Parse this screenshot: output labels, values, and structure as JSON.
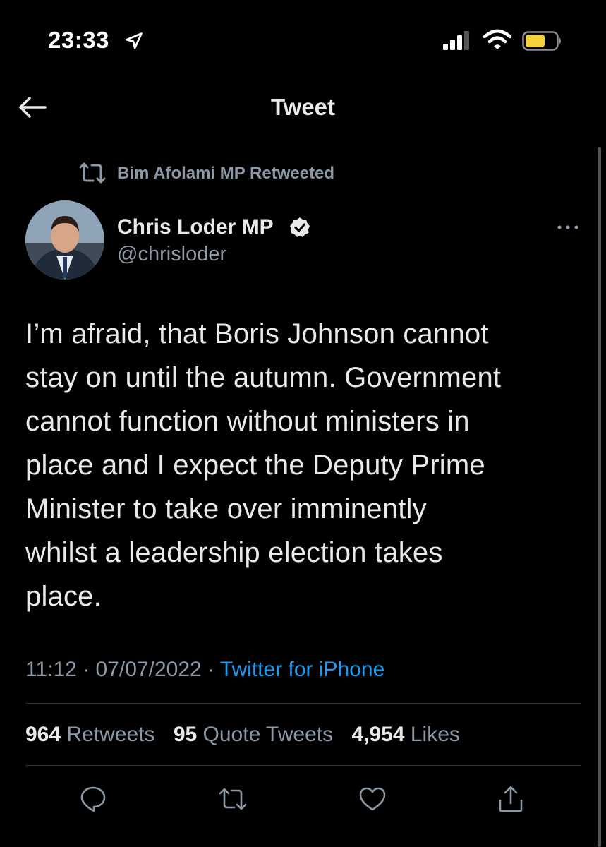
{
  "status_bar": {
    "time": "23:33"
  },
  "nav": {
    "title": "Tweet"
  },
  "retweet_context": {
    "text": "Bim Afolami MP Retweeted"
  },
  "author": {
    "name": "Chris Loder MP",
    "handle": "@chrisloder"
  },
  "tweet": {
    "lines": [
      "I’m afraid, that Boris Johnson cannot",
      "stay on until the autumn. Government",
      "cannot function without ministers in",
      "place and I expect the Deputy Prime",
      "Minister to take over imminently",
      "whilst a leadership election takes",
      "place."
    ],
    "time": "11:12",
    "date": "07/07/2022",
    "separator": "·",
    "source": "Twitter for iPhone"
  },
  "stats": {
    "retweets": {
      "count": "964",
      "label": "Retweets"
    },
    "quotes": {
      "count": "95",
      "label": "Quote Tweets"
    },
    "likes": {
      "count": "4,954",
      "label": "Likes"
    }
  },
  "colors": {
    "background": "#000000",
    "text": "#e7e9ea",
    "muted": "#8b98a5",
    "link": "#1d9bf0",
    "battery": "#f5d13c"
  },
  "icons": [
    "location-arrow-icon",
    "signal-icon",
    "wifi-icon",
    "battery-icon",
    "back-arrow-icon",
    "retweet-icon",
    "verified-badge-icon",
    "more-icon",
    "reply-icon",
    "share-icon"
  ]
}
